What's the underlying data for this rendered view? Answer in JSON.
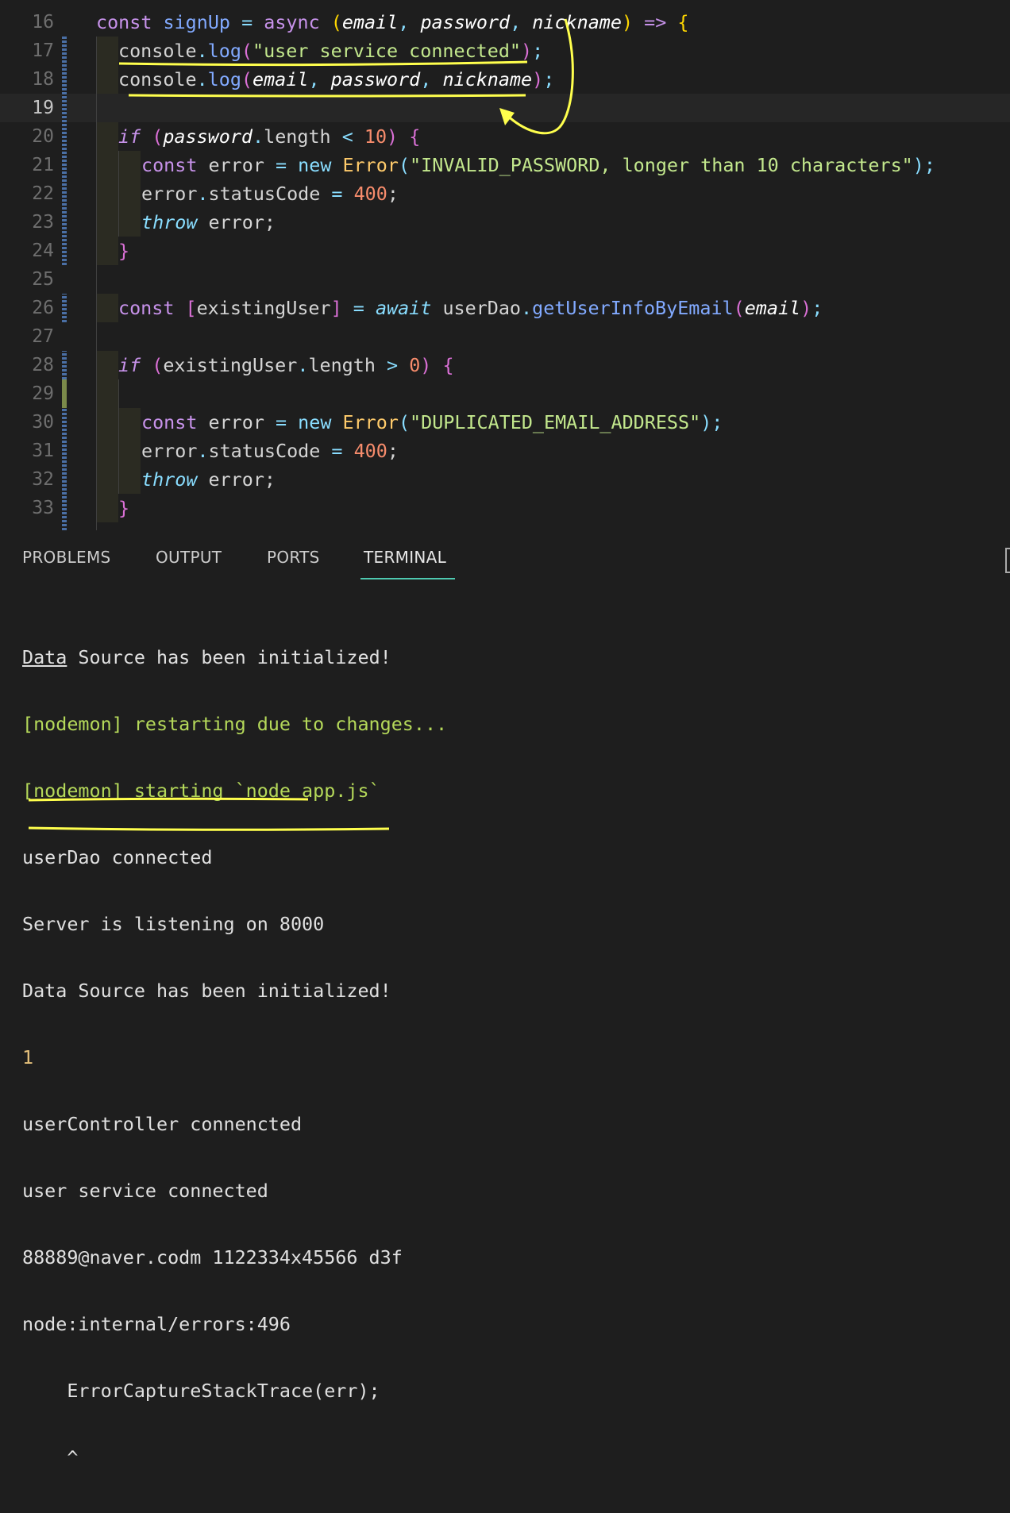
{
  "editor": {
    "active_line": 19,
    "lines": [
      {
        "n": "16"
      },
      {
        "n": "17"
      },
      {
        "n": "18"
      },
      {
        "n": "19"
      },
      {
        "n": "20"
      },
      {
        "n": "21"
      },
      {
        "n": "22"
      },
      {
        "n": "23"
      },
      {
        "n": "24"
      },
      {
        "n": "25"
      },
      {
        "n": "26"
      },
      {
        "n": "27"
      },
      {
        "n": "28"
      },
      {
        "n": "29"
      },
      {
        "n": "30"
      },
      {
        "n": "31"
      },
      {
        "n": "32"
      },
      {
        "n": "33"
      }
    ],
    "code": {
      "l16": {
        "const": "const",
        "name": "signUp",
        "eq": " = ",
        "async": "async",
        "open": " (",
        "p1": "email",
        "c1": ", ",
        "p2": "password",
        "c2": ", ",
        "p3": "nickname",
        "close": ")",
        "arrow": " => ",
        "brace": "{"
      },
      "l17": {
        "obj": "console",
        "dot": ".",
        "fn": "log",
        "open": "(",
        "str": "\"user service connected\"",
        "close": ")",
        "semi": ";"
      },
      "l18": {
        "obj": "console",
        "dot": ".",
        "fn": "log",
        "open": "(",
        "p1": "email",
        "c1": ", ",
        "p2": "password",
        "c2": ", ",
        "p3": "nickname",
        "close": ")",
        "semi": ";"
      },
      "l20": {
        "kw": "if",
        "open": " (",
        "obj": "password",
        "dot": ".",
        "prop": "length",
        "op": " < ",
        "num": "10",
        "close": ") ",
        "brace": "{"
      },
      "l21": {
        "const": "const",
        "var": " error ",
        "eq": "=",
        "new": " new ",
        "cls": "Error",
        "open": "(",
        "str": "\"INVALID_PASSWORD, longer than 10 characters\"",
        "close": ")",
        "semi": ";"
      },
      "l22": {
        "obj": "error",
        "dot": ".",
        "prop": "statusCode",
        "eq": " = ",
        "num": "400",
        "semi": ";"
      },
      "l23": {
        "kw": "throw",
        "rest": " error;"
      },
      "l24": {
        "brace": "}"
      },
      "l26": {
        "const": "const",
        "open": " [",
        "var": "existingUser",
        "close": "]",
        "eq": " = ",
        "await": "await",
        "obj": " userDao",
        "dot": ".",
        "fn": "getUserInfoByEmail",
        "po": "(",
        "p1": "email",
        "pc": ")",
        "semi": ";"
      },
      "l28": {
        "kw": "if",
        "open": " (",
        "obj": "existingUser",
        "dot": ".",
        "prop": "length",
        "op": " > ",
        "num": "0",
        "close": ") ",
        "brace": "{"
      },
      "l30": {
        "const": "const",
        "var": " error ",
        "eq": "=",
        "new": " new ",
        "cls": "Error",
        "open": "(",
        "str": "\"DUPLICATED_EMAIL_ADDRESS\"",
        "close": ")",
        "semi": ";"
      },
      "l31": {
        "obj": "error",
        "dot": ".",
        "prop": "statusCode",
        "eq": " = ",
        "num": "400",
        "semi": ";"
      },
      "l32": {
        "kw": "throw",
        "rest": " error;"
      },
      "l33": {
        "brace": "}"
      }
    }
  },
  "panel": {
    "tabs": [
      "PROBLEMS",
      "OUTPUT",
      "PORTS",
      "TERMINAL"
    ],
    "active_tab": "TERMINAL",
    "terminal_lines": [
      {
        "a": "Data",
        "b": " Source has been initialized!",
        "color": "white"
      },
      {
        "text": "[nodemon] restarting due to changes...",
        "color": "green"
      },
      {
        "text": "[nodemon] starting `node app.js`",
        "color": "green"
      },
      {
        "text": "userDao connected",
        "color": "white"
      },
      {
        "text": "Server is listening on 8000",
        "color": "white"
      },
      {
        "text": "Data Source has been initialized!",
        "color": "white"
      },
      {
        "text": "1",
        "color": "yellow"
      },
      {
        "text": "userController connencted",
        "color": "white"
      },
      {
        "text": "user service connected",
        "color": "white"
      },
      {
        "text": "88889@naver.codm 1122334x45566 d3f",
        "color": "white"
      },
      {
        "text": "node:internal/errors:496",
        "color": "white"
      },
      {
        "text": "    ErrorCaptureStackTrace(err);",
        "color": "white"
      },
      {
        "text": "    ^",
        "color": "white"
      }
    ]
  },
  "annotation_color": "#ffff4d"
}
